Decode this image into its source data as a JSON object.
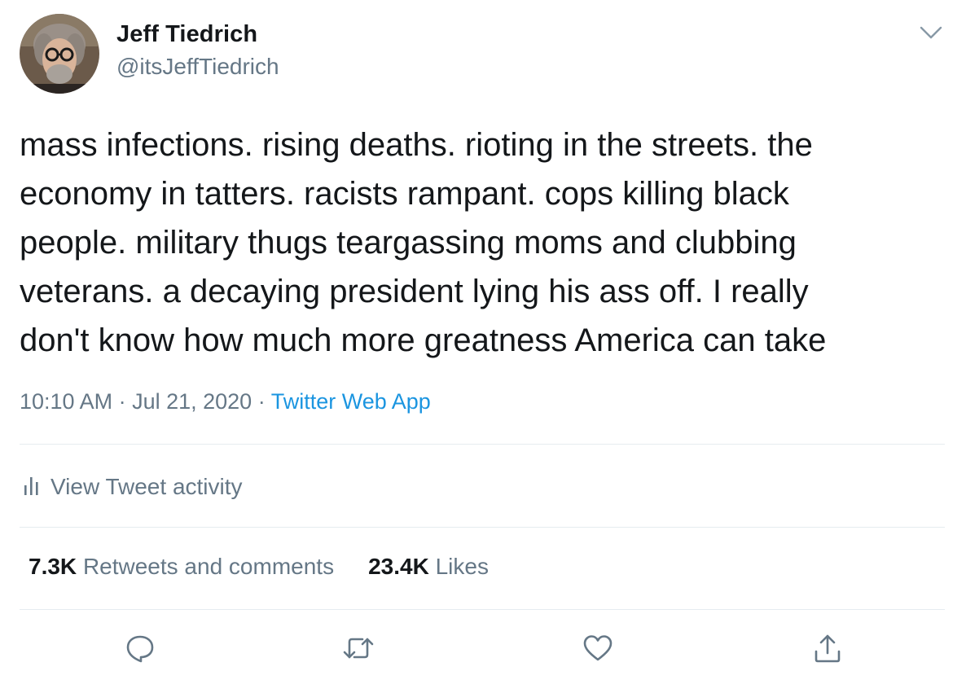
{
  "author": {
    "display_name": "Jeff Tiedrich",
    "handle": "@itsJeffTiedrich"
  },
  "tweet": {
    "text": "mass infections. rising deaths. rioting in the streets. the\neconomy in tatters. racists rampant. cops killing black\npeople. military thugs teargassing moms and clubbing\nveterans. a decaying president lying his ass off. I really\ndon't know how much more greatness America can take",
    "time": "10:10 AM",
    "date": "Jul 21, 2020",
    "separator": " · ",
    "source": "Twitter Web App"
  },
  "activity": {
    "label": "View Tweet activity"
  },
  "stats": {
    "retweets_count": "7.3K",
    "retweets_label": "Retweets and comments",
    "likes_count": "23.4K",
    "likes_label": "Likes"
  },
  "icons": {
    "caret": "chevron-down-icon",
    "activity": "bar-chart-icon",
    "reply": "reply-icon",
    "retweet": "retweet-icon",
    "like": "heart-icon",
    "share": "share-icon"
  },
  "colors": {
    "text": "#14171a",
    "secondary": "#657786",
    "link": "#1b95e0",
    "divider": "#e6ecf0"
  }
}
